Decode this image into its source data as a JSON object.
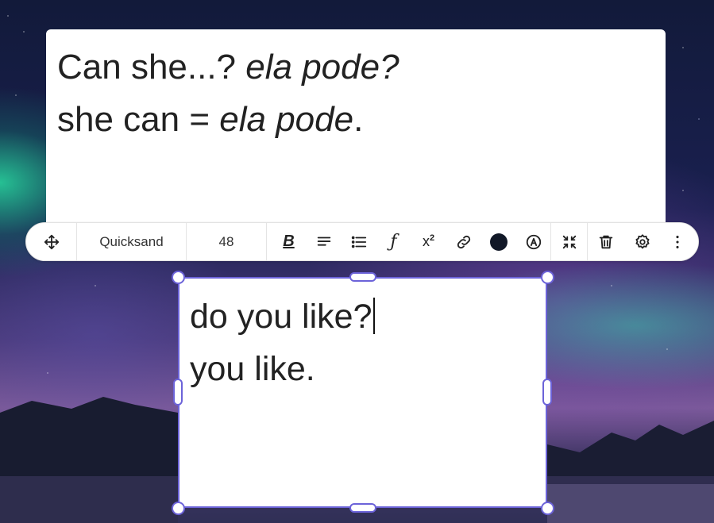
{
  "top_card": {
    "line1_main": "Can she...? ",
    "line1_italic": "ela pode?",
    "line2_main": "she can = ",
    "line2_italic": "ela pode",
    "line2_end": "."
  },
  "toolbar": {
    "font_name": "Quicksand",
    "font_size": "48",
    "bold_label": "B",
    "function_label": "ƒ",
    "superscript_base": "x",
    "superscript_exp": "2",
    "text_color": "#111827"
  },
  "selected_card": {
    "line1": "do you like?",
    "line2": "you like."
  },
  "colors": {
    "selection": "#6c63d9"
  }
}
